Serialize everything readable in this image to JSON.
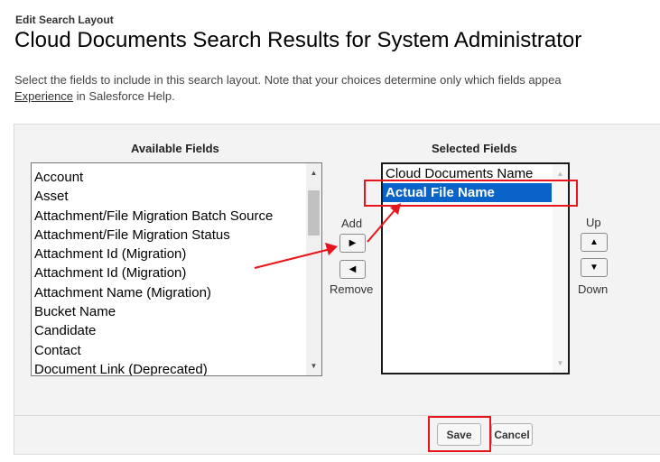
{
  "header": {
    "section_label": "Edit Search Layout",
    "title": "Cloud Documents Search Results for System Administrator"
  },
  "description": {
    "line1": "Select the fields to include in this search layout. Note that your choices determine only which fields appea",
    "link_text": "Experience",
    "line2_rest": " in Salesforce Help."
  },
  "available": {
    "label": "Available Fields",
    "items": [
      "Account",
      "Asset",
      "Attachment/File Migration Batch Source",
      "Attachment/File Migration Status",
      "Attachment Id (Migration)",
      "Attachment Id (Migration)",
      "Attachment Name (Migration)",
      "Bucket Name",
      "Candidate",
      "Contact",
      "Document Link (Deprecated)"
    ]
  },
  "selected": {
    "label": "Selected Fields",
    "items": [
      "Cloud Documents Name",
      "Actual File Name"
    ],
    "selected_index": 1
  },
  "controls": {
    "add_label": "Add",
    "remove_label": "Remove",
    "up_label": "Up",
    "down_label": "Down",
    "add_icon": "triangle-right",
    "remove_icon": "triangle-left",
    "up_icon": "triangle-up",
    "down_icon": "triangle-down"
  },
  "buttons": {
    "save": "Save",
    "cancel": "Cancel"
  },
  "colors": {
    "selection": "#0a63c9",
    "annotation": "#e8141b"
  }
}
